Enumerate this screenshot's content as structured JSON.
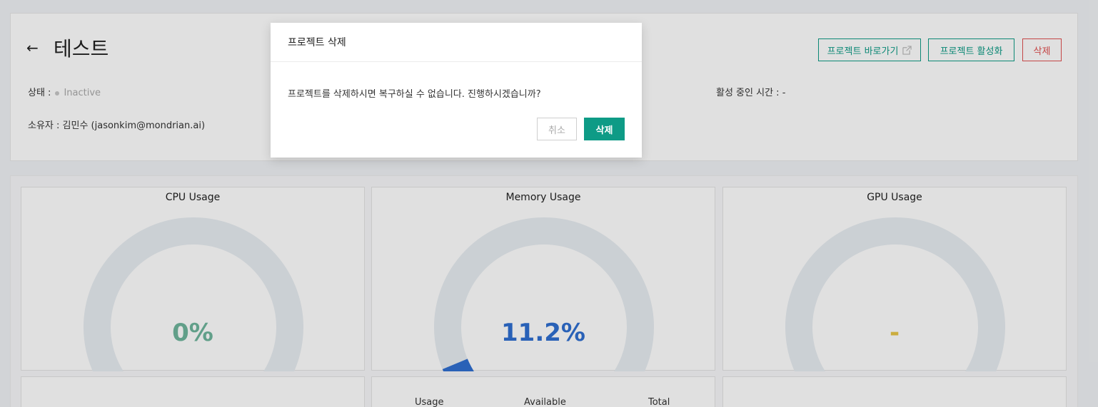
{
  "header": {
    "back_icon": "arrow-left-icon",
    "title": "테스트",
    "status_label": "상태 :",
    "status_value": "Inactive",
    "owner_label": "소유자 :",
    "owner_value": "김민수 (jasonkim@mondrian.ai)",
    "active_time_label": "활성 중인 시간 :",
    "active_time_value": "-",
    "buttons": {
      "goto_label": "프로젝트 바로가기",
      "goto_icon": "external-link-icon",
      "activate_label": "프로젝트 활성화",
      "delete_label": "삭제"
    }
  },
  "gauges": [
    {
      "title": "CPU Usage",
      "value_text": "0%",
      "fraction": 0.0,
      "color": "#6fb59c"
    },
    {
      "title": "Memory Usage",
      "value_text": "11.2%",
      "fraction": 0.112,
      "color": "#2f6fd1"
    },
    {
      "title": "GPU Usage",
      "value_text": "-",
      "fraction": 0.0,
      "color": "#e8c547"
    }
  ],
  "gauge_track_color": "#e8edf2",
  "memory_table": {
    "columns": [
      "Usage",
      "Available",
      "Total"
    ]
  },
  "modal": {
    "title": "프로젝트 삭제",
    "message": "프로젝트를 삭제하시면 복구하실 수 없습니다. 진행하시겠습니까?",
    "cancel_label": "취소",
    "confirm_label": "삭제"
  },
  "colors": {
    "accent": "#0e9b86",
    "danger": "#e05050"
  }
}
